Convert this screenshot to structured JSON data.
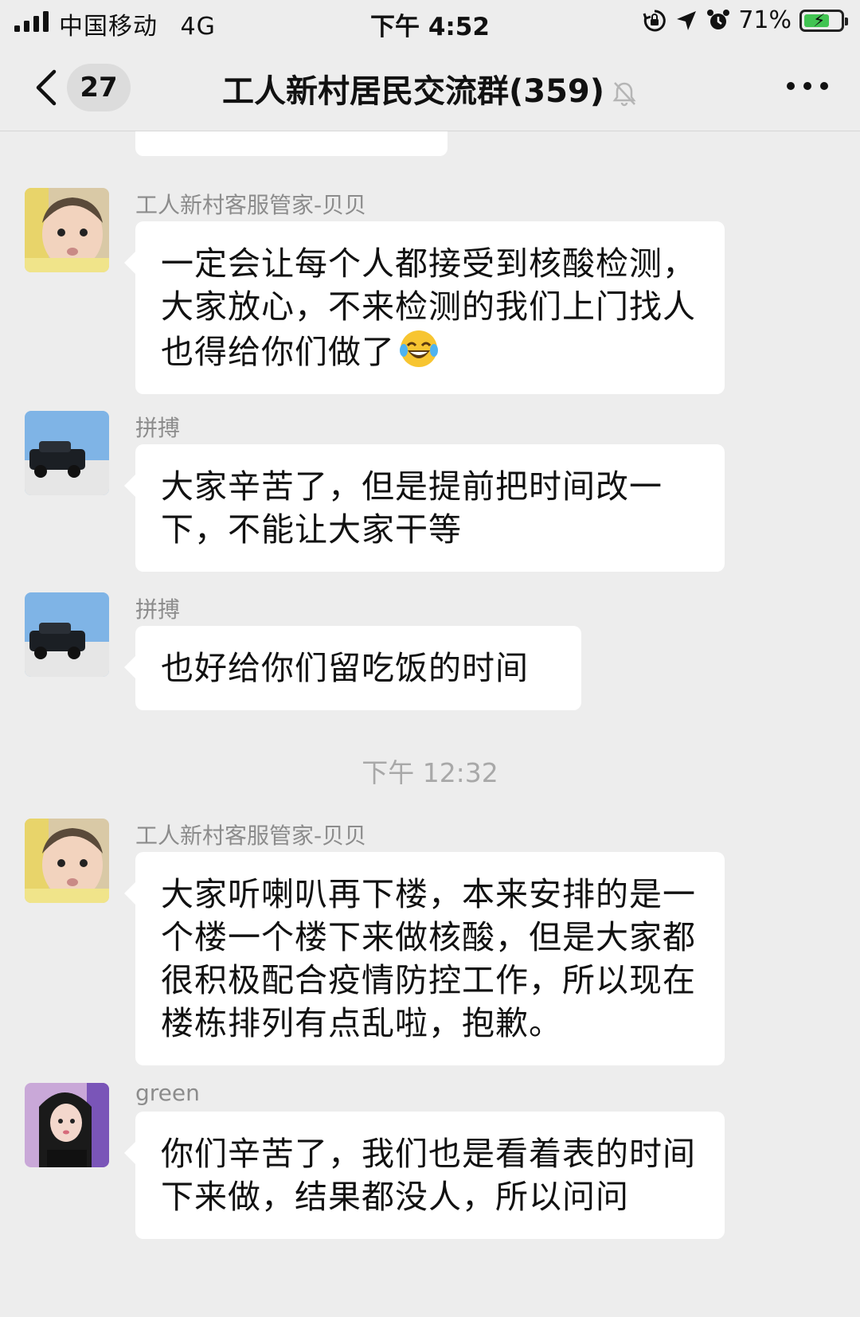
{
  "status_bar": {
    "carrier": "中国移动",
    "network": "4G",
    "time": "下午 4:52",
    "battery_percent": "71%",
    "battery_level": 0.71
  },
  "nav": {
    "unread_count": "27",
    "title": "工人新村居民交流群(359)"
  },
  "messages": [
    {
      "sender": "工人新村客服管家-贝贝",
      "text": "一定会让每个人都接受到核酸检测，大家放心，不来检测的我们上门找人也得给你们做了",
      "emoji": "face-with-tears-of-joy"
    },
    {
      "sender": "拼搏",
      "text": "大家辛苦了，但是提前把时间改一下，不能让大家干等"
    },
    {
      "sender": "拼搏",
      "text": "也好给你们留吃饭的时间"
    },
    {
      "sender": "工人新村客服管家-贝贝",
      "text": "大家听喇叭再下楼，本来安排的是一个楼一个楼下来做核酸，但是大家都很积极配合疫情防控工作，所以现在楼栋排列有点乱啦，抱歉。"
    },
    {
      "sender": "green",
      "text": "你们辛苦了，我们也是看着表的时间下来做，结果都没人，所以问问"
    }
  ],
  "timestamp_divider": "下午 12:32",
  "colors": {
    "background": "#ededed",
    "bubble": "#ffffff",
    "name_gray": "#8c8c8c",
    "timestamp_gray": "#a8a8a8",
    "battery_green": "#41c452"
  }
}
